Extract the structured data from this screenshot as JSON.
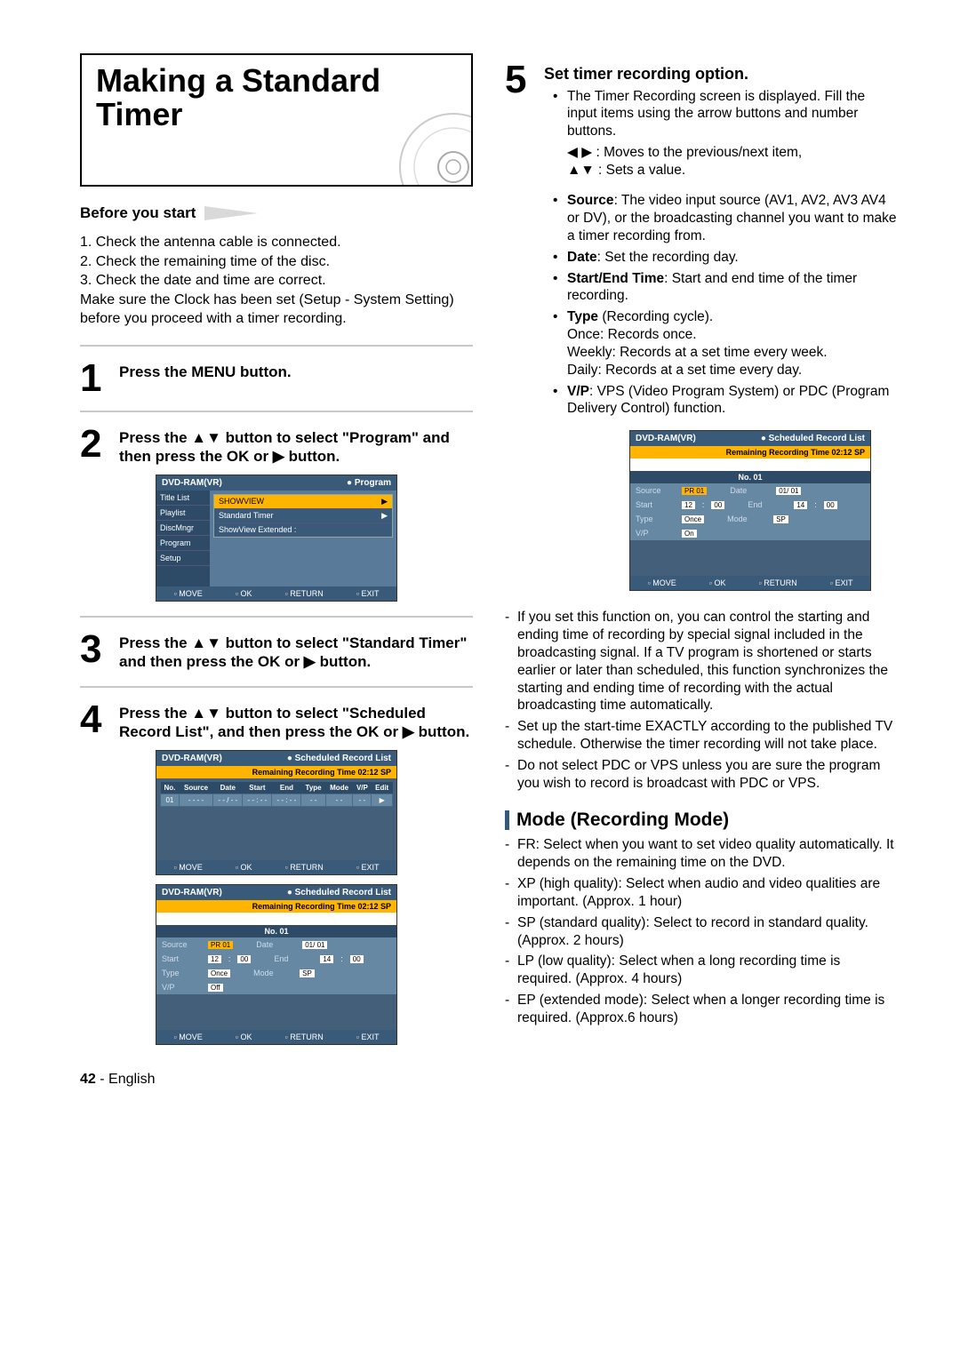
{
  "page_title_l1": "Making a Standard",
  "page_title_l2": "Timer",
  "before_you_start_label": "Before you start",
  "intro_lines": {
    "l1": "1. Check the antenna cable is connected.",
    "l2": "2. Check the remaining time of the disc.",
    "l3": "3. Check the date and time are correct.",
    "l4": "Make sure the Clock has been set (Setup - System Setting) before you proceed with a timer recording."
  },
  "step1": {
    "num": "1",
    "text": "Press the MENU button."
  },
  "step2": {
    "num": "2",
    "text": "Press the ▲▼ button to select \"Program\" and then press the OK or ▶ button."
  },
  "step3": {
    "num": "3",
    "text": "Press the ▲▼ button to select \"Standard Timer\" and then press the OK or ▶ button."
  },
  "step4": {
    "num": "4",
    "text": "Press the ▲▼ button to select \"Scheduled Record List\", and then press the OK or ▶ button."
  },
  "step5": {
    "num": "5",
    "heading": "Set timer recording option.",
    "b1": "The Timer Recording screen is displayed. Fill the input items using the arrow buttons and number buttons.",
    "b1a": "◀ ▶ : Moves to the previous/next item,",
    "b1b": "▲▼ : Sets a value.",
    "src_label": "Source",
    "src_text": ": The video input source (AV1, AV2, AV3 AV4 or DV), or the broadcasting channel you want to make a timer recording from.",
    "date_label": "Date",
    "date_text": ": Set the recording day.",
    "se_label": "Start/End Time",
    "se_text": ": Start and end time of the timer recording.",
    "type_label": "Type",
    "type_text": " (Recording cycle).",
    "type_once": "Once: Records once.",
    "type_weekly": "Weekly: Records at a set time every week.",
    "type_daily": "Daily: Records at a set time every day.",
    "vp_label": "V/P",
    "vp_text": ": VPS (Video Program System) or PDC (Program Delivery Control) function.",
    "d1": "If you set this function on, you can control the starting and ending time of recording by special signal included in the broadcasting signal. If a TV program is shortened or starts earlier or later than scheduled, this function synchronizes the starting and ending time of recording with the actual broadcasting time automatically.",
    "d2": "Set up the start-time EXACTLY according to the published TV schedule. Otherwise the timer recording will not take place.",
    "d3": "Do not select PDC or VPS unless you are sure the program you wish to record is broadcast with PDC or VPS."
  },
  "mode_heading": "Mode (Recording Mode)",
  "mode": {
    "fr": "FR: Select when you want to set video quality automatically. It depends on the remaining time on the DVD.",
    "xp": "XP (high quality): Select when audio and video qualities are important. (Approx. 1 hour)",
    "sp": "SP (standard quality): Select to record in standard quality. (Approx. 2 hours)",
    "lp": "LP (low quality): Select when a long recording time is required. (Approx. 4 hours)",
    "ep": "EP (extended mode): Select when a longer recording time is required. (Approx.6 hours)"
  },
  "screen_generic": {
    "dvdram": "DVD-RAM(VR)",
    "program": "Program",
    "srl": "Scheduled Record List",
    "remaining": "Remaining Recording Time 02:12 SP",
    "move": "MOVE",
    "ok": "OK",
    "return": "RETURN",
    "exit": "EXIT"
  },
  "screen2_sidebar": {
    "s1": "Title List",
    "s2": "Playlist",
    "s3": "DiscMngr",
    "s4": "Program",
    "s5": "Setup"
  },
  "screen2_menu": {
    "m1": "SHOWVIEW",
    "m2": "Standard Timer",
    "m3": "ShowView Extended   :"
  },
  "screen4_table": {
    "h_no": "No.",
    "h_src": "Source",
    "h_date": "Date",
    "h_start": "Start",
    "h_end": "End",
    "h_type": "Type",
    "h_mode": "Mode",
    "h_vp": "V/P",
    "h_edit": "Edit",
    "r_no": "01",
    "r_src": "- - - -",
    "r_date": "- - / - -",
    "r_start": "- - : - -",
    "r_end": "- - : - -",
    "r_type": "- -",
    "r_mode": "- -",
    "r_vp": "- -",
    "r_edit": "▶"
  },
  "screen_form": {
    "hdr": "No. 01",
    "src_l": "Source",
    "src_v": "PR 01",
    "date_l": "Date",
    "date_v": "01/ 01",
    "start_l": "Start",
    "start_v1": "12",
    "start_v2": "00",
    "end_l": "End",
    "end_v1": "14",
    "end_v2": "00",
    "type_l": "Type",
    "type_v": "Once",
    "mode_l": "Mode",
    "mode_v": "SP",
    "vp_l": "V/P",
    "vp_v_off": "Off",
    "vp_v_on": "On"
  },
  "footer": {
    "page": "42",
    "dash": " - ",
    "lang": "English"
  }
}
